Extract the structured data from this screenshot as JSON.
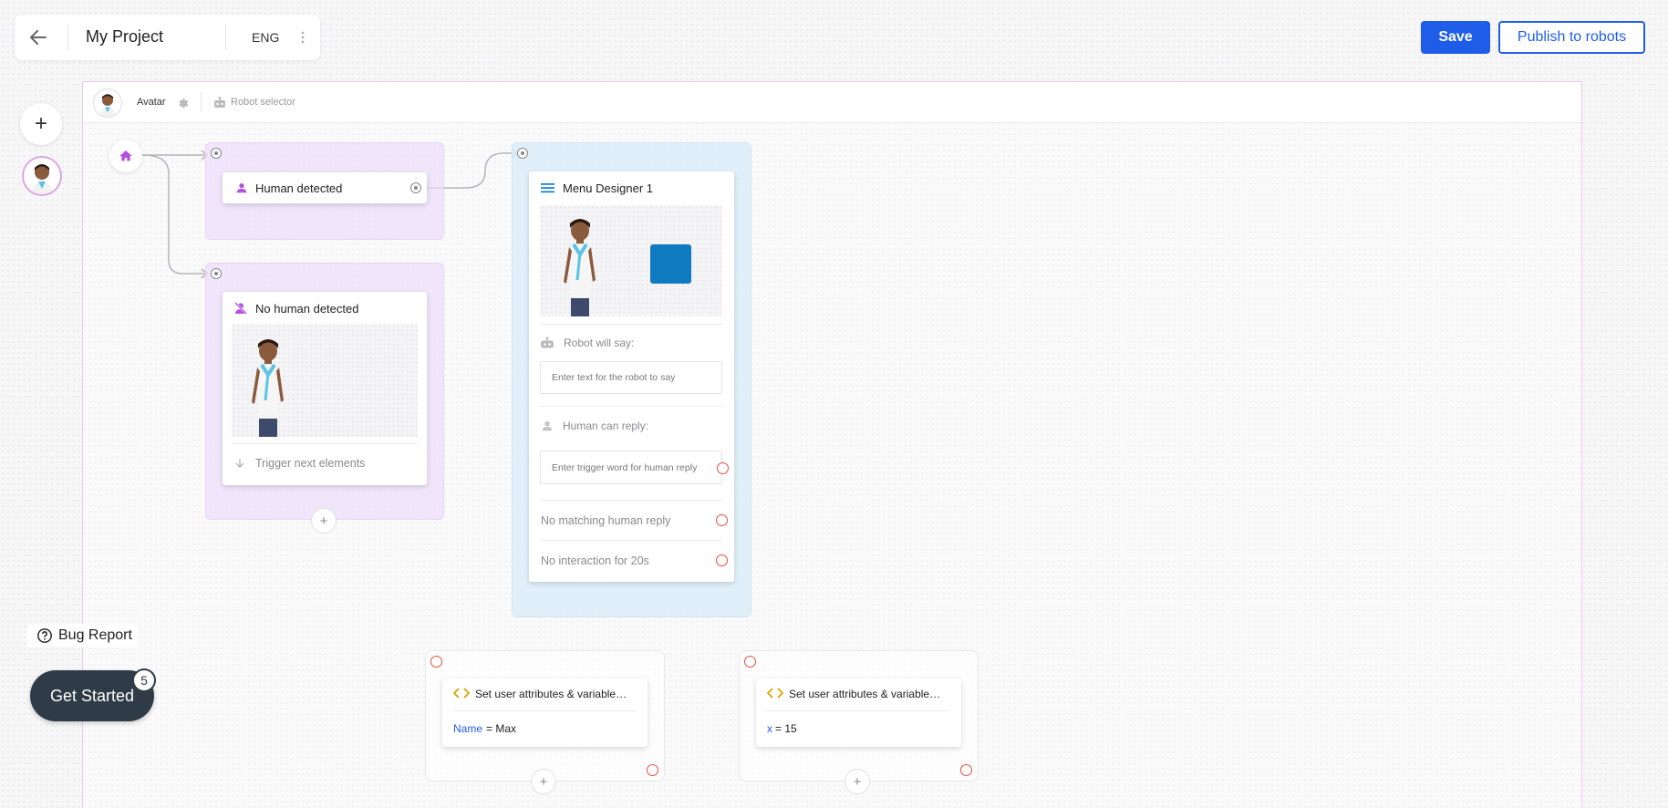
{
  "topbar": {
    "project_title": "My Project",
    "language": "ENG",
    "save_label": "Save",
    "publish_label": "Publish to robots"
  },
  "sidebar": {
    "add_label": "+"
  },
  "canvas_header": {
    "avatar_label": "Avatar",
    "robot_selector_label": "Robot selector"
  },
  "nodes": {
    "human_detected": {
      "title": "Human detected"
    },
    "no_human_detected": {
      "title": "No human detected",
      "trigger_label": "Trigger next elements"
    },
    "menu_designer": {
      "title": "Menu Designer 1",
      "robot_say_label": "Robot will say:",
      "robot_say_placeholder": "Enter text for the robot to say",
      "human_reply_label": "Human can reply:",
      "human_reply_placeholder": "Enter trigger word for human reply",
      "no_match_label": "No matching human reply",
      "no_interaction_label": "No interaction for 20s"
    },
    "set_attr_1": {
      "title": "Set user attributes & variable…",
      "var_name": "Name",
      "var_value": "= Max"
    },
    "set_attr_2": {
      "title": "Set user attributes & variable…",
      "var_name": "x",
      "var_value": "= 15"
    }
  },
  "footer": {
    "bug_report_label": "Bug Report",
    "get_started_label": "Get Started",
    "get_started_badge": "5"
  },
  "colors": {
    "primary": "#1f5de8",
    "purple_group": "#efe4fb",
    "blue_group": "#dcecf8",
    "accent_purple": "#b44fe0",
    "error_red": "#e84c3d",
    "var_blue": "#1f5de8",
    "code_icon": "#e0a200",
    "menu_icon": "#1b86c9",
    "media_square": "#0f7ac0",
    "get_started_bg": "#2f3b47"
  }
}
